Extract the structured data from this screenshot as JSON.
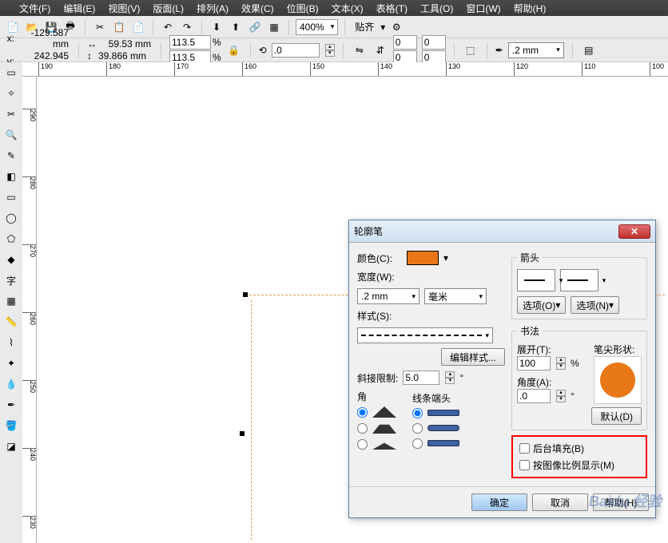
{
  "menu": {
    "file": "文件(F)",
    "edit": "编辑(E)",
    "view": "视图(V)",
    "layout": "版面(L)",
    "arrange": "排列(A)",
    "effects": "效果(C)",
    "bitmap": "位图(B)",
    "text": "文本(X)",
    "table": "表格(T)",
    "tools": "工具(O)",
    "window": "窗口(W)",
    "help": "帮助(H)"
  },
  "toolbar": {
    "zoom": "400%",
    "dock": "贴齐"
  },
  "props": {
    "x_lbl": "x:",
    "x": "-129.587 mm",
    "y_lbl": "y:",
    "y": "242.945 mm",
    "w": "59.53 mm",
    "h": "39.866 mm",
    "sx": "113.5",
    "sy": "113.5",
    "pct": "%",
    "rot": ".0",
    "sk1": "0",
    "sk2": "0",
    "sk3": "0",
    "sk4": "0",
    "stroke": ".2 mm"
  },
  "ruler_h": [
    "190",
    "180",
    "170",
    "160",
    "150",
    "140",
    "130",
    "120",
    "110",
    "100"
  ],
  "ruler_v": [
    "290",
    "280",
    "270",
    "260",
    "250",
    "240",
    "230"
  ],
  "dialog": {
    "title": "轮廓笔",
    "color_lbl": "颜色(C):",
    "width_lbl": "宽度(W):",
    "width_val": ".2 mm",
    "width_unit": "毫米",
    "style_lbl": "样式(S):",
    "edit_style": "编辑样式...",
    "miter_lbl": "斜接限制:",
    "miter_val": "5.0",
    "corner_lbl": "角",
    "cap_lbl": "线条端头",
    "arrow_lbl": "箭头",
    "opt1": "选项(O)",
    "opt2": "选项(N)",
    "callig_lbl": "书法",
    "stretch_lbl": "展开(T):",
    "stretch_val": "100",
    "stretch_pct": "%",
    "angle_lbl": "角度(A):",
    "angle_val": ".0",
    "penshape_lbl": "笔尖形状:",
    "default": "默认(D)",
    "bgfill": "后台填充(B)",
    "scale": "按图像比例显示(M)",
    "ok": "确定",
    "cancel": "取消",
    "help": "帮助(H)"
  },
  "watermark": "Baidu 经验"
}
